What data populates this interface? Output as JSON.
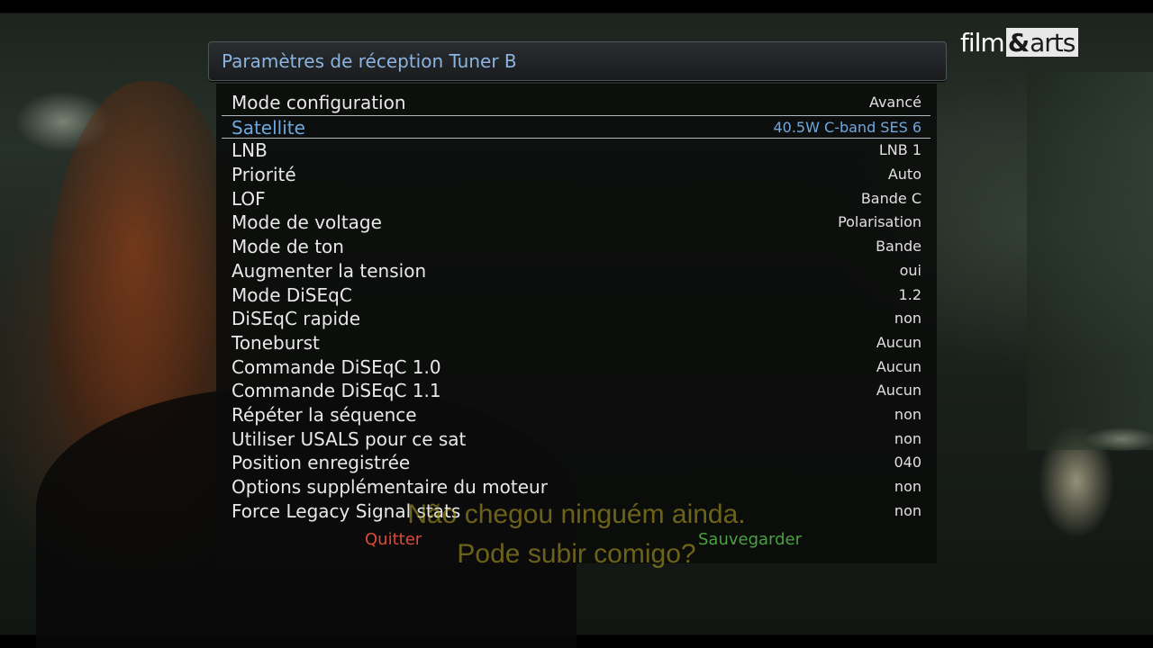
{
  "screen": {
    "title": "Paramètres de réception Tuner B",
    "logo": {
      "film": "film",
      "amp": "&",
      "arts": "arts"
    },
    "subtitles": [
      "Não chegou ninguém ainda.",
      "Pode subir comigo?"
    ],
    "colors": {
      "title_text": "#8cb4e0",
      "selected": "#6fa8e0",
      "quit": "#e04a3a",
      "save": "#4aa040"
    }
  },
  "settings": [
    {
      "label": "Mode configuration",
      "value": "Avancé"
    },
    {
      "label": "Satellite",
      "value": "40.5W C-band SES 6",
      "selected": true
    },
    {
      "label": "LNB",
      "value": "LNB 1"
    },
    {
      "label": "Priorité",
      "value": "Auto"
    },
    {
      "label": "LOF",
      "value": "Bande C"
    },
    {
      "label": "Mode de voltage",
      "value": "Polarisation"
    },
    {
      "label": "Mode de ton",
      "value": "Bande"
    },
    {
      "label": "Augmenter la tension",
      "value": "oui"
    },
    {
      "label": "Mode DiSEqC",
      "value": "1.2"
    },
    {
      "label": "DiSEqC rapide",
      "value": "non"
    },
    {
      "label": "Toneburst",
      "value": "Aucun"
    },
    {
      "label": "Commande DiSEqC 1.0",
      "value": "Aucun"
    },
    {
      "label": "Commande DiSEqC 1.1",
      "value": "Aucun"
    },
    {
      "label": "Répéter la séquence",
      "value": "non"
    },
    {
      "label": "Utiliser USALS pour ce sat",
      "value": "non"
    },
    {
      "label": "Position enregistrée",
      "value": "040"
    },
    {
      "label": "Options supplémentaire du moteur",
      "value": "non"
    },
    {
      "label": "Force Legacy Signal stats",
      "value": "non"
    }
  ],
  "buttons": {
    "quit": "Quitter",
    "save": "Sauvegarder"
  }
}
